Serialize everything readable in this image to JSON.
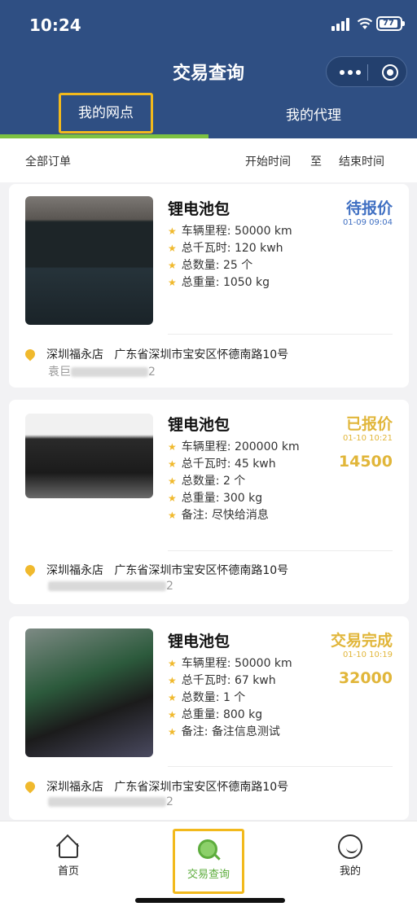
{
  "status_bar": {
    "time": "10:24",
    "battery": "77"
  },
  "nav": {
    "title": "交易查询",
    "more_icon": "more-dots-icon",
    "close_icon": "target-icon"
  },
  "tabs": [
    {
      "label": "我的网点",
      "active": true
    },
    {
      "label": "我的代理",
      "active": false
    }
  ],
  "filter": {
    "all_orders": "全部订单",
    "start_time": "开始时间",
    "to": "至",
    "end_time": "结束时间"
  },
  "labels": {
    "mileage": "车辆里程:",
    "kwh": "总千瓦时:",
    "quantity": "总数量:",
    "weight": "总重量:",
    "remark": "备注:"
  },
  "orders": [
    {
      "title": "锂电池包",
      "mileage": "50000 km",
      "kwh": "120 kwh",
      "quantity": "25 个",
      "weight": "1050 kg",
      "status": "待报价",
      "status_color": "#3f6fc2",
      "status_time": "01-09 09:04",
      "store": "深圳福永店",
      "address": "广东省深圳市宝安区怀德南路10号",
      "contact_prefix": "袁巨",
      "contact_suffix": "2"
    },
    {
      "title": "锂电池包",
      "mileage": "200000 km",
      "kwh": "45 kwh",
      "quantity": "2 个",
      "weight": "300 kg",
      "remark": "尽快给消息",
      "status": "已报价",
      "status_color": "#e1b63a",
      "status_time": "01-10 10:21",
      "price": "14500",
      "store": "深圳福永店",
      "address": "广东省深圳市宝安区怀德南路10号",
      "contact_prefix": "",
      "contact_suffix": "2"
    },
    {
      "title": "锂电池包",
      "mileage": "50000 km",
      "kwh": "67 kwh",
      "quantity": "1 个",
      "weight": "800 kg",
      "remark": "备注信息测试",
      "status": "交易完成",
      "status_color": "#e1b63a",
      "status_time": "01-10 10:19",
      "price": "32000",
      "store": "深圳福永店",
      "address": "广东省深圳市宝安区怀德南路10号",
      "contact_prefix": "",
      "contact_suffix": "2"
    }
  ],
  "bottom_nav": [
    {
      "label": "首页",
      "icon": "home-icon"
    },
    {
      "label": "交易查询",
      "icon": "search-icon",
      "active": true,
      "color": "#5dad3d"
    },
    {
      "label": "我的",
      "icon": "smile-icon"
    }
  ]
}
